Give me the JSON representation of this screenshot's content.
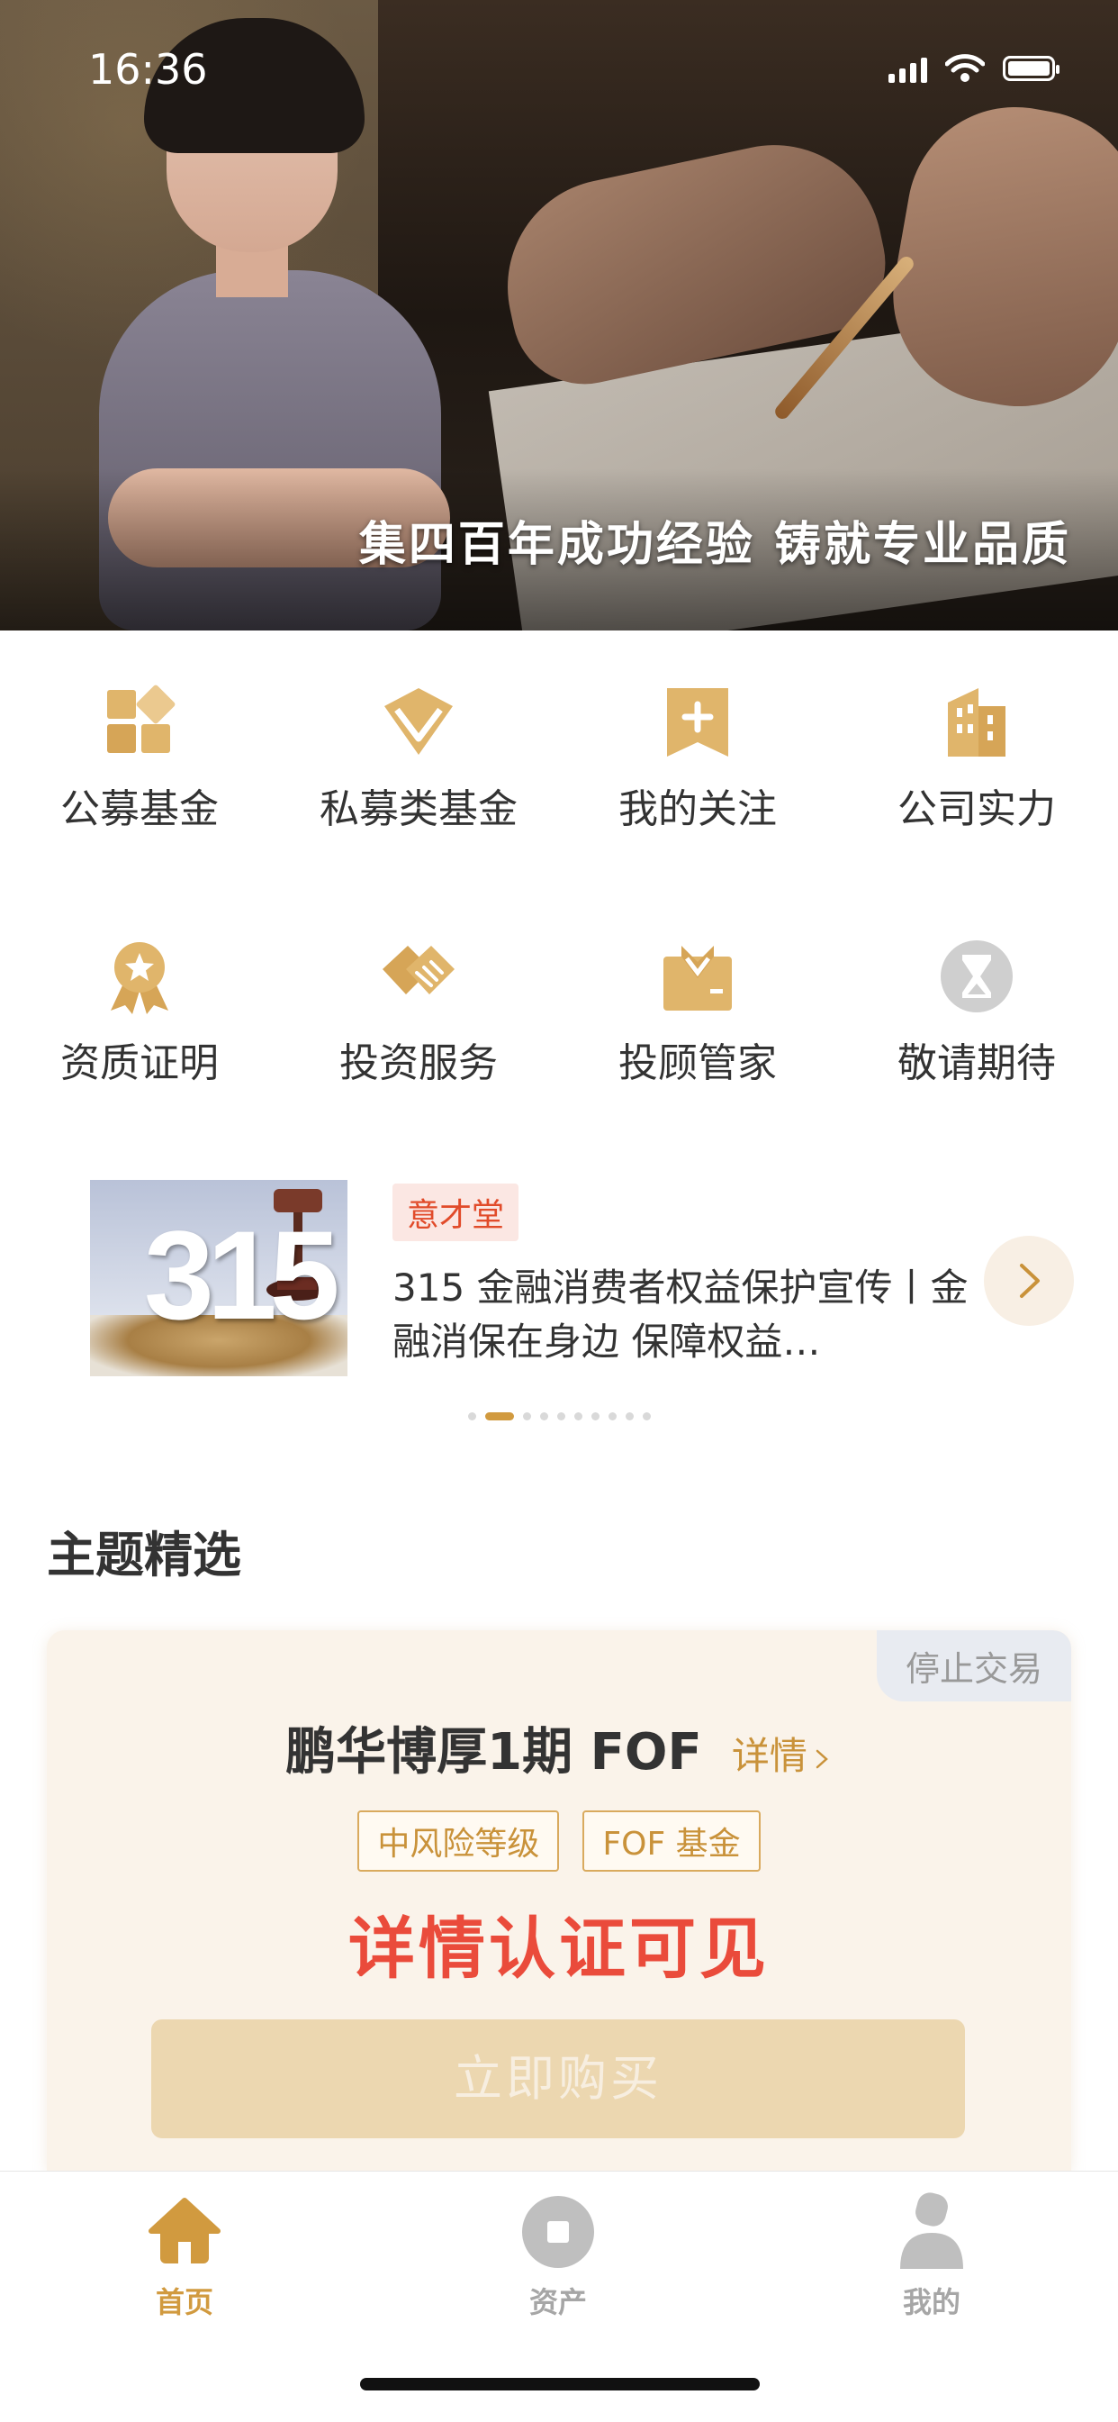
{
  "status_bar": {
    "time": "16:36"
  },
  "hero": {
    "slogan": "集四百年成功经验 铸就专业品质"
  },
  "grid": [
    {
      "label": "公募基金",
      "icon": "blocks-icon"
    },
    {
      "label": "私募类基金",
      "icon": "diamond-icon"
    },
    {
      "label": "我的关注",
      "icon": "bookmark-plus-icon"
    },
    {
      "label": "公司实力",
      "icon": "building-icon"
    },
    {
      "label": "资质证明",
      "icon": "award-icon"
    },
    {
      "label": "投资服务",
      "icon": "handshake-icon"
    },
    {
      "label": "投顾管家",
      "icon": "butler-icon"
    },
    {
      "label": "敬请期待",
      "icon": "hourglass-icon"
    }
  ],
  "news": {
    "tag": "意才堂",
    "title": "315 金融消费者权益保护宣传丨金融消保在身边 保障权益…",
    "thumb_text": "315",
    "dots_count": 10,
    "active_dot": 1
  },
  "section": {
    "title": "主题精选"
  },
  "theme_card": {
    "badge": "停止交易",
    "name": "鹏华博厚1期 FOF",
    "detail_link": "详情",
    "tags": [
      "中风险等级",
      "FOF 基金"
    ],
    "highlight": "详情认证可见",
    "buy_button": "立即购买"
  },
  "tabbar": [
    {
      "label": "首页",
      "active": true,
      "icon": "home-icon"
    },
    {
      "label": "资产",
      "active": false,
      "icon": "asset-icon"
    },
    {
      "label": "我的",
      "active": false,
      "icon": "user-icon"
    }
  ],
  "colors": {
    "accent": "#D19A3F",
    "icon_gold": "#E0B56B",
    "highlight_red": "#EA4B3B",
    "tag_red": "#E14B2A",
    "inactive": "#BFBFBF"
  }
}
